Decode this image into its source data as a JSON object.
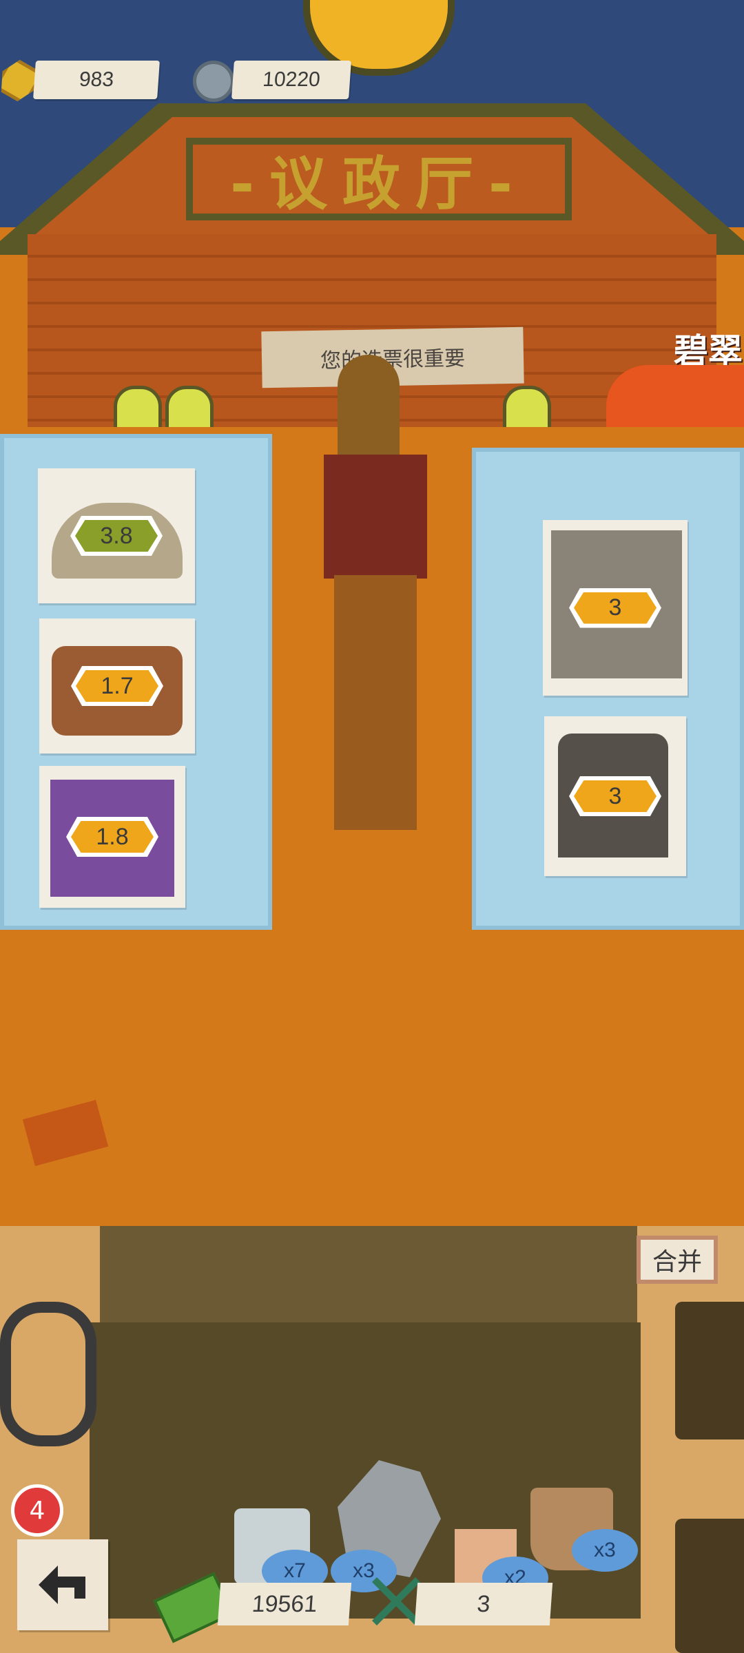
{
  "currency": {
    "gold": "983",
    "nuts": "10220"
  },
  "hall": {
    "sign": "-议政厅-",
    "notice": "您的选票很重要",
    "side_label": "碧翠"
  },
  "left_panel": {
    "items": [
      {
        "icon": "hat-icon",
        "value": "3.8"
      },
      {
        "icon": "bag-icon",
        "value": "1.7"
      },
      {
        "icon": "sweater-icon",
        "value": "1.8"
      }
    ]
  },
  "right_panel": {
    "items": [
      {
        "icon": "pants-icon",
        "value": "3"
      },
      {
        "icon": "boots-icon",
        "value": "3"
      }
    ]
  },
  "inventory": {
    "merge_label": "合并",
    "timer_badge": "4",
    "money": "19561",
    "tools": "3",
    "items": [
      {
        "icon": "cloth-icon",
        "count": "x7"
      },
      {
        "icon": "stone-icon",
        "count": "x3"
      },
      {
        "icon": "wood-icon",
        "count": "x2"
      },
      {
        "icon": "bucket-icon",
        "count": "x3"
      }
    ]
  },
  "colors": {
    "sky": "#2f4a7a",
    "ground": "#d4791a",
    "panel": "#a9d3e6",
    "badge": "#efa61b"
  }
}
